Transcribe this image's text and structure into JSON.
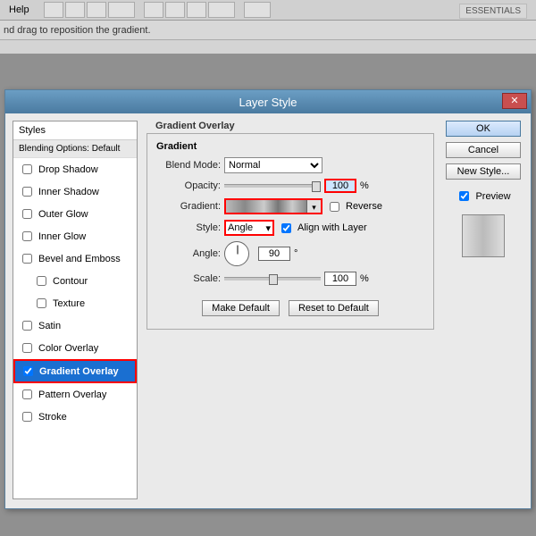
{
  "menu": {
    "help": "Help"
  },
  "workspace_btn": "ESSENTIALS",
  "hint": "nd drag to reposition the gradient.",
  "dialog": {
    "title": "Layer Style",
    "close": "✕",
    "styles_header": "Styles",
    "blending_options": "Blending Options: Default",
    "styles": {
      "drop_shadow": "Drop Shadow",
      "inner_shadow": "Inner Shadow",
      "outer_glow": "Outer Glow",
      "inner_glow": "Inner Glow",
      "bevel": "Bevel and Emboss",
      "contour": "Contour",
      "texture": "Texture",
      "satin": "Satin",
      "color_overlay": "Color Overlay",
      "gradient_overlay": "Gradient Overlay",
      "pattern_overlay": "Pattern Overlay",
      "stroke": "Stroke"
    },
    "section_title": "Gradient Overlay",
    "sub_section": "Gradient",
    "labels": {
      "blend_mode": "Blend Mode:",
      "opacity": "Opacity:",
      "gradient": "Gradient:",
      "style": "Style:",
      "angle": "Angle:",
      "scale": "Scale:",
      "reverse": "Reverse",
      "align": "Align with Layer",
      "percent": "%",
      "degree": "°"
    },
    "values": {
      "blend_mode": "Normal",
      "opacity": "100",
      "style": "Angle",
      "angle": "90",
      "scale": "100"
    },
    "buttons": {
      "make_default": "Make Default",
      "reset_default": "Reset to Default",
      "ok": "OK",
      "cancel": "Cancel",
      "new_style": "New Style...",
      "preview": "Preview"
    }
  }
}
